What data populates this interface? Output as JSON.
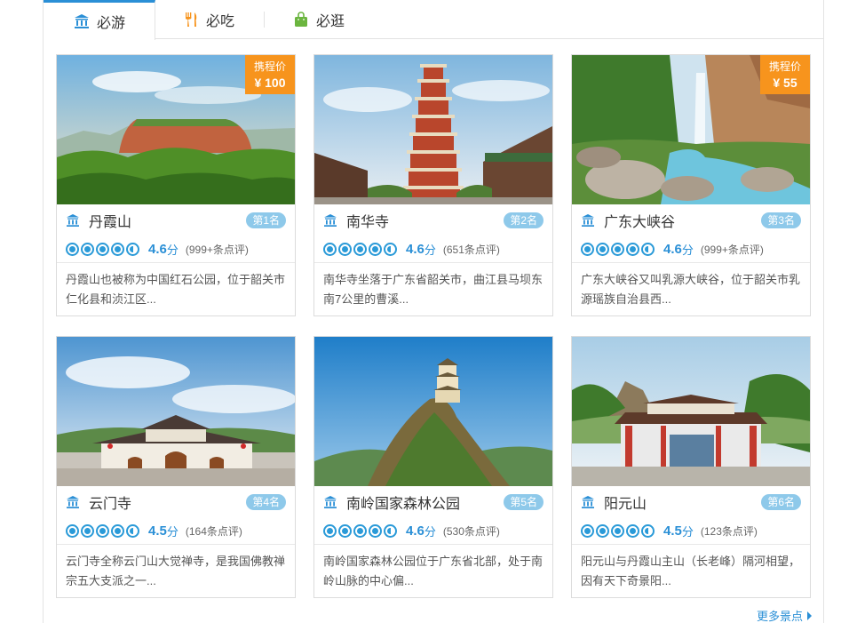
{
  "tabs": [
    {
      "label": "必游",
      "icon": "museum-icon",
      "active": true
    },
    {
      "label": "必吃",
      "icon": "fork-knife-icon",
      "active": false
    },
    {
      "label": "必逛",
      "icon": "shopping-bag-icon",
      "active": false
    }
  ],
  "colors": {
    "accent": "#2a8fd6",
    "price": "#f7941d",
    "rank_badge": "#8ec9ea"
  },
  "cards": [
    {
      "name": "丹霞山",
      "rank": "第1名",
      "price_label": "携程价",
      "price": "¥ 100",
      "score": "4.6",
      "unit": "分",
      "reviews": "(999+条点评)",
      "stars": 4.5,
      "desc": "丹霞山也被称为中国红石公园，位于韶关市仁化县和浈江区..."
    },
    {
      "name": "南华寺",
      "rank": "第2名",
      "score": "4.6",
      "unit": "分",
      "reviews": "(651条点评)",
      "stars": 4.5,
      "desc": "南华寺坐落于广东省韶关市，曲江县马坝东南7公里的曹溪..."
    },
    {
      "name": "广东大峡谷",
      "rank": "第3名",
      "price_label": "携程价",
      "price": "¥ 55",
      "score": "4.6",
      "unit": "分",
      "reviews": "(999+条点评)",
      "stars": 4.5,
      "desc": "广东大峡谷又叫乳源大峡谷，位于韶关市乳源瑶族自治县西..."
    },
    {
      "name": "云门寺",
      "rank": "第4名",
      "score": "4.5",
      "unit": "分",
      "reviews": "(164条点评)",
      "stars": 4.5,
      "desc": "云门寺全称云门山大觉禅寺，是我国佛教禅宗五大支派之一..."
    },
    {
      "name": "南岭国家森林公园",
      "rank": "第5名",
      "score": "4.6",
      "unit": "分",
      "reviews": "(530条点评)",
      "stars": 4.5,
      "desc": "南岭国家森林公园位于广东省北部，处于南岭山脉的中心偏..."
    },
    {
      "name": "阳元山",
      "rank": "第6名",
      "score": "4.5",
      "unit": "分",
      "reviews": "(123条点评)",
      "stars": 4.5,
      "desc": "阳元山与丹霞山主山（长老峰）隔河相望，因有天下奇景阳..."
    }
  ],
  "more_link": "更多景点"
}
